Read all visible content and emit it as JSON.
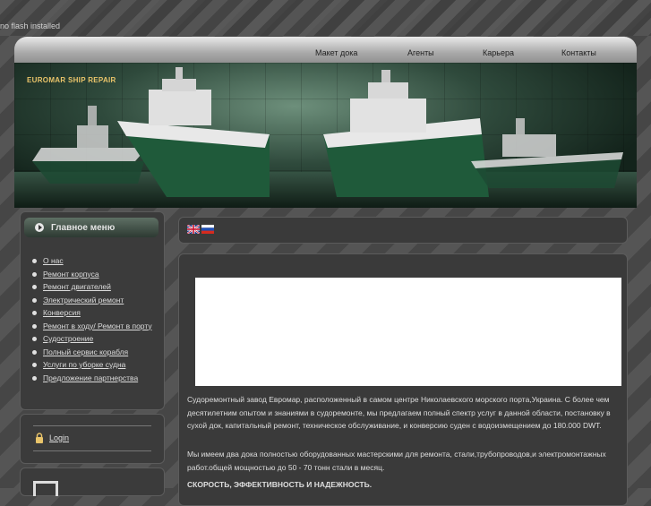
{
  "notice": "no flash installed",
  "nav": [
    "Макет дока",
    "Агенты",
    "Карьера",
    "Контакты"
  ],
  "banner": {
    "brand": "EUROMAR SHIP REPAIR"
  },
  "menu": {
    "title": "Главное меню",
    "items": [
      "О нас",
      "Ремонт корпуса",
      "Ремонт двигателей",
      "Электрический ремонт",
      "Конверсия",
      "Ремонт в ходу/ Ремонт в порту",
      "Судостроение",
      "Полный сервис корабля",
      "Услуги по уборке судна",
      "Предложение партнерства"
    ]
  },
  "login": {
    "label": "Login"
  },
  "languages": [
    "English",
    "Русский"
  ],
  "content": {
    "p1": "Судоремонтный завод Евромар, расположенный в самом центре Николаевского морского порта,Украина. С более чем десятилетним опытом и знаниями в судоремонте, мы  предлагаем полный спектр услуг в данной области, постановку в сухой док, капитальный ремонт, техническое обслуживание, и конверсию суден с водоизмещением до 180.000 DWT.",
    "p2": "Мы имеем два дока полностью оборудованных мастерскими для ремонта, стали,трубопроводов,и электромонтажных работ.общей мощностью до 50 - 70 тонн стали в месяц.",
    "p3": "СКОРОСТЬ, ЭФФЕКТИВНОСТЬ И НАДЕЖНОСТЬ."
  },
  "colors": {
    "accent": "#e9c46a",
    "background": "#4a4a4a",
    "panel": "#3a3a3a"
  }
}
